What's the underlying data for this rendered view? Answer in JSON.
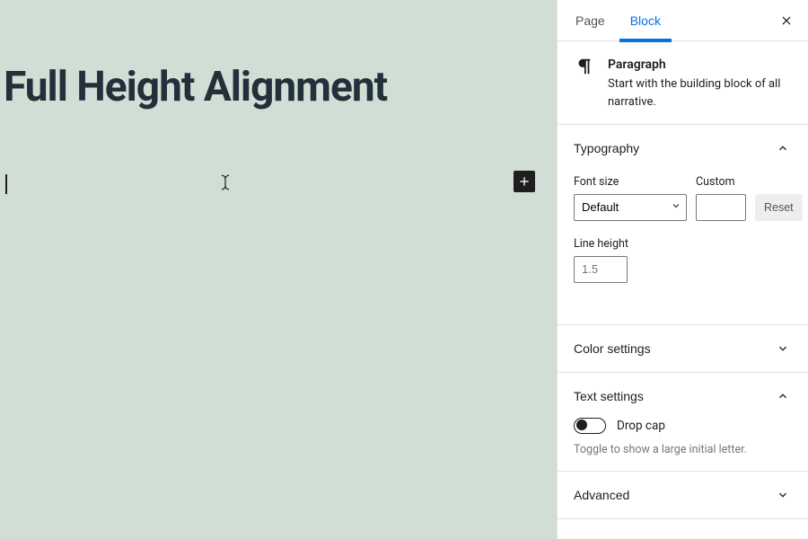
{
  "canvas": {
    "title": "Full Height Alignment"
  },
  "sidebar": {
    "tabs": {
      "page": "Page",
      "block": "Block"
    },
    "block_info": {
      "name": "Paragraph",
      "description": "Start with the building block of all narrative."
    },
    "panels": {
      "typography": {
        "title": "Typography",
        "font_size_label": "Font size",
        "font_size_value": "Default",
        "custom_label": "Custom",
        "custom_value": "",
        "reset_label": "Reset",
        "line_height_label": "Line height",
        "line_height_placeholder": "1.5"
      },
      "color": {
        "title": "Color settings"
      },
      "text": {
        "title": "Text settings",
        "drop_cap_label": "Drop cap",
        "drop_cap_help": "Toggle to show a large initial letter."
      },
      "advanced": {
        "title": "Advanced"
      }
    }
  }
}
